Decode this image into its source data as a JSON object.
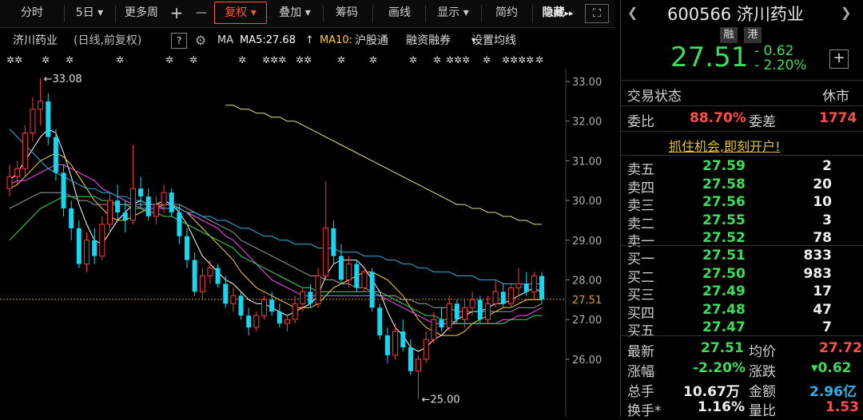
{
  "toolbar": {
    "fenshi": "分时",
    "period": "5日",
    "more": "更多周",
    "plus": "+",
    "minus": "—",
    "fuquan": "复权",
    "diejia": "叠加",
    "chouma": "筹码",
    "huaxian": "画线",
    "xianshi": "显示",
    "jianyue": "简约",
    "hide": "隐藏",
    "hide_arrow": "▸▸",
    "fullscreen": "⛶"
  },
  "legend": {
    "name": "济川药业",
    "mode": "(日线,前复权)",
    "help": "?",
    "ma_label": "MA",
    "ma5": "MA5:27.68",
    "ma10": "MA10:",
    "hgt": "沪股通",
    "rzrq": "融资融券",
    "setting": "设置均线"
  },
  "chart_labels": {
    "high": "←33.08",
    "low": "←25.00",
    "current": "27.51",
    "yticks": [
      "33.00",
      "32.00",
      "31.00",
      "30.00",
      "29.00",
      "28.00",
      "27.00",
      "26.00"
    ]
  },
  "colors": {
    "up": "#ff3b3b",
    "down": "#17d6ef",
    "ma5": "#ffffff",
    "ma10": "#ffd23a",
    "ma20": "#ff4dff",
    "ma30": "#3ddc5a",
    "ma60": "#9aa0a6",
    "ma120": "#33b0e6",
    "ma250": "#e6e08a"
  },
  "quote": {
    "code_name": "600566 济川药业",
    "rong": "融",
    "gang": "港",
    "price": "27.51",
    "change": "- 0.62",
    "change_pct": "- 2.20%",
    "trade_status_label": "交易状态",
    "trade_status": "休市",
    "weibi_label": "委比",
    "weibi": "88.70%",
    "weicha_label": "委差",
    "weicha": "1774",
    "promo": "抓住机会,即刻开户!"
  },
  "orderbook": {
    "asks": [
      {
        "label": "卖五",
        "price": "27.59",
        "vol": "2"
      },
      {
        "label": "卖四",
        "price": "27.58",
        "vol": "20"
      },
      {
        "label": "卖三",
        "price": "27.56",
        "vol": "10"
      },
      {
        "label": "卖二",
        "price": "27.55",
        "vol": "3"
      },
      {
        "label": "卖一",
        "price": "27.52",
        "vol": "78"
      }
    ],
    "bids": [
      {
        "label": "买一",
        "price": "27.51",
        "vol": "833"
      },
      {
        "label": "买二",
        "price": "27.50",
        "vol": "983"
      },
      {
        "label": "买三",
        "price": "27.49",
        "vol": "17"
      },
      {
        "label": "买四",
        "price": "27.48",
        "vol": "47"
      },
      {
        "label": "买五",
        "price": "27.47",
        "vol": "7"
      }
    ]
  },
  "stats": {
    "latest_label": "最新",
    "latest": "27.51",
    "avg_label": "均价",
    "avg": "27.72",
    "pct_label": "涨幅",
    "pct": "-2.20%",
    "chg_label": "涨跌",
    "chg": "▾0.62",
    "vol_label": "总手",
    "vol": "10.67万",
    "amt_label": "金额",
    "amt": "2.96亿",
    "turn_label": "换手*",
    "turn": "1.16%",
    "lb_label": "量比",
    "lb": "1.53"
  },
  "chart_data": {
    "type": "candlestick",
    "ylim": [
      25,
      33.3
    ],
    "high": 33.08,
    "low": 25.0,
    "last": 27.51,
    "ohlc": [
      [
        30.3,
        30.9,
        30.1,
        30.6
      ],
      [
        30.6,
        31.0,
        30.4,
        30.8
      ],
      [
        30.8,
        31.9,
        30.6,
        31.7
      ],
      [
        31.7,
        32.6,
        31.5,
        32.3
      ],
      [
        32.3,
        33.08,
        31.9,
        32.5
      ],
      [
        32.5,
        32.7,
        31.4,
        31.6
      ],
      [
        31.6,
        31.8,
        30.5,
        30.7
      ],
      [
        30.7,
        30.9,
        29.6,
        29.8
      ],
      [
        29.8,
        30.0,
        29.0,
        29.3
      ],
      [
        29.3,
        29.5,
        28.3,
        28.4
      ],
      [
        28.4,
        29.2,
        28.2,
        29.0
      ],
      [
        29.0,
        29.3,
        28.4,
        28.6
      ],
      [
        28.6,
        29.6,
        28.5,
        29.4
      ],
      [
        29.4,
        30.2,
        29.2,
        30.0
      ],
      [
        30.0,
        30.4,
        29.5,
        29.7
      ],
      [
        29.7,
        30.0,
        29.2,
        29.5
      ],
      [
        29.5,
        31.4,
        29.4,
        30.3
      ],
      [
        30.3,
        30.6,
        29.8,
        30.1
      ],
      [
        30.1,
        30.3,
        29.5,
        29.6
      ],
      [
        29.6,
        30.1,
        29.4,
        29.9
      ],
      [
        29.9,
        30.4,
        29.7,
        30.2
      ],
      [
        30.2,
        30.3,
        29.6,
        29.7
      ],
      [
        29.7,
        29.9,
        28.9,
        29.1
      ],
      [
        29.1,
        29.3,
        28.3,
        28.5
      ],
      [
        28.5,
        28.7,
        27.6,
        27.7
      ],
      [
        27.7,
        28.3,
        27.5,
        28.1
      ],
      [
        28.1,
        28.5,
        27.9,
        28.3
      ],
      [
        28.3,
        28.4,
        27.8,
        27.9
      ],
      [
        27.9,
        28.1,
        27.3,
        27.4
      ],
      [
        27.4,
        27.8,
        27.2,
        27.6
      ],
      [
        27.6,
        27.7,
        27.0,
        27.1
      ],
      [
        27.1,
        27.3,
        26.6,
        26.8
      ],
      [
        26.8,
        27.2,
        26.7,
        27.1
      ],
      [
        27.1,
        27.6,
        27.0,
        27.5
      ],
      [
        27.5,
        27.7,
        27.1,
        27.2
      ],
      [
        27.2,
        27.4,
        26.8,
        26.9
      ],
      [
        26.9,
        27.1,
        26.7,
        27.0
      ],
      [
        27.0,
        27.6,
        26.9,
        27.4
      ],
      [
        27.4,
        27.8,
        27.2,
        27.7
      ],
      [
        27.7,
        27.9,
        27.3,
        27.4
      ],
      [
        27.4,
        28.3,
        27.3,
        28.1
      ],
      [
        28.1,
        30.5,
        28.0,
        29.3
      ],
      [
        29.3,
        29.5,
        28.4,
        28.6
      ],
      [
        28.6,
        28.9,
        27.9,
        28.0
      ],
      [
        28.0,
        28.6,
        27.8,
        28.4
      ],
      [
        28.4,
        28.5,
        27.7,
        27.8
      ],
      [
        27.8,
        28.3,
        27.7,
        28.2
      ],
      [
        28.2,
        28.3,
        27.2,
        27.3
      ],
      [
        27.3,
        27.4,
        26.5,
        26.6
      ],
      [
        26.6,
        26.8,
        25.9,
        26.1
      ],
      [
        26.1,
        26.9,
        26.0,
        26.7
      ],
      [
        26.7,
        27.0,
        26.2,
        26.3
      ],
      [
        26.3,
        26.5,
        25.6,
        25.7
      ],
      [
        25.7,
        26.1,
        25.0,
        26.0
      ],
      [
        26.0,
        26.7,
        25.9,
        26.5
      ],
      [
        26.5,
        27.2,
        26.4,
        27.0
      ],
      [
        27.0,
        27.3,
        26.7,
        26.8
      ],
      [
        26.8,
        27.6,
        26.7,
        27.4
      ],
      [
        27.4,
        27.5,
        26.9,
        27.0
      ],
      [
        27.0,
        27.5,
        26.8,
        27.3
      ],
      [
        27.3,
        27.7,
        27.1,
        27.5
      ],
      [
        27.5,
        27.6,
        26.9,
        27.0
      ],
      [
        27.0,
        27.6,
        26.9,
        27.4
      ],
      [
        27.4,
        28.0,
        27.3,
        27.7
      ],
      [
        27.7,
        27.9,
        27.3,
        27.4
      ],
      [
        27.4,
        27.9,
        27.3,
        27.8
      ],
      [
        27.8,
        28.3,
        27.6,
        27.9
      ],
      [
        27.9,
        28.2,
        27.6,
        27.7
      ],
      [
        27.7,
        28.2,
        27.5,
        28.1
      ],
      [
        28.1,
        28.2,
        27.4,
        27.51
      ]
    ],
    "ma_series": [
      {
        "name": "MA5",
        "values": [
          30.5,
          30.7,
          31.0,
          31.3,
          31.6,
          31.8,
          31.7,
          31.2,
          30.6,
          29.9,
          29.4,
          29.0,
          28.9,
          29.2,
          29.5,
          29.7,
          29.9,
          30.0,
          29.9,
          29.9,
          30.0,
          29.9,
          29.7,
          29.4,
          29.0,
          28.6,
          28.4,
          28.2,
          28.0,
          27.9,
          27.7,
          27.5,
          27.4,
          27.4,
          27.3,
          27.2,
          27.1,
          27.2,
          27.3,
          27.4,
          27.6,
          28.1,
          28.4,
          28.5,
          28.5,
          28.5,
          28.3,
          28.0,
          27.7,
          27.2,
          26.8,
          26.6,
          26.3,
          26.2,
          26.3,
          26.5,
          26.6,
          26.8,
          27.0,
          27.1,
          27.2,
          27.2,
          27.3,
          27.4,
          27.4,
          27.5,
          27.6,
          27.7,
          27.8,
          27.68
        ]
      },
      {
        "name": "MA10",
        "values": [
          30.3,
          30.4,
          30.6,
          30.8,
          31.0,
          31.1,
          31.2,
          31.1,
          30.9,
          30.6,
          30.3,
          30.0,
          29.8,
          29.6,
          29.5,
          29.5,
          29.6,
          29.7,
          29.8,
          29.8,
          29.9,
          29.9,
          29.8,
          29.7,
          29.5,
          29.3,
          29.1,
          28.9,
          28.7,
          28.5,
          28.2,
          28.0,
          27.8,
          27.7,
          27.6,
          27.5,
          27.4,
          27.3,
          27.3,
          27.3,
          27.4,
          27.6,
          27.8,
          27.9,
          28.0,
          28.1,
          28.2,
          28.2,
          28.1,
          28.0,
          27.8,
          27.6,
          27.3,
          27.0,
          26.8,
          26.7,
          26.6,
          26.6,
          26.6,
          26.7,
          26.9,
          27.0,
          27.1,
          27.2,
          27.3,
          27.3,
          27.4,
          27.5,
          27.5,
          27.5
        ]
      },
      {
        "name": "MA20",
        "values": [
          30.4,
          30.5,
          30.5,
          30.6,
          30.7,
          30.8,
          30.9,
          30.9,
          30.8,
          30.7,
          30.6,
          30.5,
          30.3,
          30.2,
          30.1,
          30.0,
          29.9,
          29.8,
          29.8,
          29.8,
          29.8,
          29.8,
          29.8,
          29.7,
          29.6,
          29.5,
          29.4,
          29.3,
          29.1,
          29.0,
          28.8,
          28.6,
          28.4,
          28.2,
          28.0,
          27.9,
          27.8,
          27.7,
          27.6,
          27.6,
          27.6,
          27.6,
          27.6,
          27.6,
          27.6,
          27.6,
          27.6,
          27.6,
          27.6,
          27.5,
          27.4,
          27.3,
          27.2,
          27.1,
          27.0,
          26.9,
          26.9,
          26.9,
          26.9,
          26.9,
          26.9,
          26.9,
          26.9,
          26.9,
          27.0,
          27.0,
          27.1,
          27.1,
          27.2,
          27.3
        ]
      },
      {
        "name": "MA30",
        "values": [
          29.0,
          29.2,
          29.4,
          29.6,
          29.8,
          29.9,
          30.0,
          30.1,
          30.1,
          30.1,
          30.1,
          30.1,
          30.0,
          30.0,
          29.9,
          29.9,
          29.8,
          29.8,
          29.7,
          29.7,
          29.6,
          29.6,
          29.5,
          29.4,
          29.3,
          29.2,
          29.1,
          29.0,
          28.9,
          28.8,
          28.6,
          28.5,
          28.4,
          28.3,
          28.2,
          28.1,
          28.0,
          27.9,
          27.8,
          27.8,
          27.7,
          27.7,
          27.7,
          27.7,
          27.7,
          27.7,
          27.7,
          27.7,
          27.6,
          27.6,
          27.5,
          27.4,
          27.3,
          27.2,
          27.1,
          27.1,
          27.0,
          27.0,
          26.9,
          26.9,
          26.9,
          26.9,
          26.9,
          26.9,
          26.9,
          27.0,
          27.0,
          27.0,
          27.1,
          27.1
        ]
      },
      {
        "name": "MA60",
        "values": [
          29.8,
          29.9,
          30.0,
          30.1,
          30.2,
          30.2,
          30.2,
          30.2,
          30.1,
          30.0,
          30.0,
          29.9,
          29.9,
          29.9,
          29.9,
          29.9,
          29.9,
          29.9,
          29.9,
          29.9,
          29.9,
          29.9,
          29.9,
          29.8,
          29.7,
          29.6,
          29.5,
          29.4,
          29.3,
          29.2,
          29.0,
          28.9,
          28.8,
          28.7,
          28.6,
          28.5,
          28.4,
          28.3,
          28.2,
          28.1,
          28.1,
          28.0,
          28.0,
          27.9,
          27.9,
          27.8,
          27.8,
          27.7,
          27.7,
          27.6,
          27.6,
          27.5,
          27.5,
          27.4,
          27.4,
          27.3,
          27.3,
          27.3,
          27.2,
          27.2,
          27.2,
          27.2,
          27.2,
          27.2,
          27.2,
          27.2,
          27.3,
          27.3,
          27.3,
          27.4
        ]
      },
      {
        "name": "MA120",
        "values": [
          31.8,
          31.6,
          31.4,
          31.2,
          31.0,
          30.8,
          30.7,
          30.6,
          30.5,
          30.4,
          30.3,
          30.3,
          30.2,
          30.2,
          30.1,
          30.1,
          30.0,
          30.0,
          29.9,
          29.9,
          29.8,
          29.8,
          29.8,
          29.7,
          29.7,
          29.6,
          29.6,
          29.5,
          29.5,
          29.4,
          29.3,
          29.3,
          29.2,
          29.1,
          29.1,
          29.0,
          29.0,
          28.9,
          28.9,
          28.9,
          28.8,
          28.8,
          28.8,
          28.7,
          28.7,
          28.7,
          28.6,
          28.6,
          28.6,
          28.5,
          28.5,
          28.4,
          28.4,
          28.3,
          28.3,
          28.2,
          28.2,
          28.2,
          28.1,
          28.1,
          28.1,
          28.0,
          28.0,
          28.0,
          27.9,
          27.9,
          27.9,
          27.9,
          27.9,
          27.9
        ]
      },
      {
        "name": "MA250",
        "values": [
          null,
          null,
          null,
          null,
          null,
          null,
          null,
          null,
          null,
          null,
          null,
          null,
          null,
          null,
          null,
          null,
          null,
          null,
          null,
          null,
          null,
          null,
          null,
          null,
          null,
          null,
          null,
          null,
          32.4,
          32.4,
          32.3,
          32.3,
          32.2,
          32.2,
          32.1,
          32.1,
          32.0,
          32.0,
          31.9,
          31.8,
          31.7,
          31.6,
          31.5,
          31.4,
          31.3,
          31.2,
          31.1,
          31.0,
          30.9,
          30.8,
          30.7,
          30.6,
          30.5,
          30.4,
          30.3,
          30.2,
          30.1,
          30.0,
          29.9,
          29.9,
          29.8,
          29.8,
          29.7,
          29.7,
          29.6,
          29.6,
          29.5,
          29.5,
          29.4,
          29.4
        ]
      }
    ]
  }
}
